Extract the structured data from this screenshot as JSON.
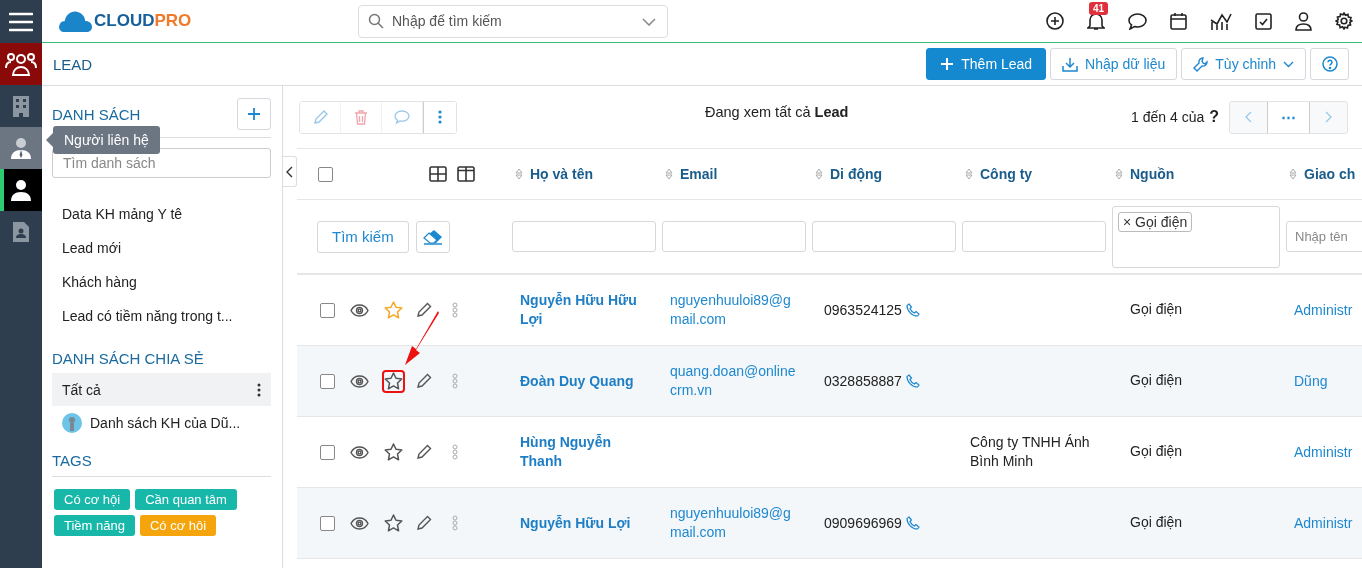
{
  "app": {
    "logo": {
      "part_1": "CLOUD",
      "part_2": "PRO"
    },
    "search": {
      "placeholder": "Nhập để tìm kiếm"
    },
    "notification_count": "41"
  },
  "rail": [
    {
      "kind": "menu",
      "selected": false,
      "hovered": false,
      "open": false
    },
    {
      "kind": "people",
      "selected": true,
      "hovered": false,
      "open": false
    },
    {
      "kind": "building",
      "selected": false,
      "hovered": false,
      "open": false
    },
    {
      "kind": "contact",
      "selected": false,
      "hovered": true,
      "open": false,
      "tooltip": "Người liên hệ"
    },
    {
      "kind": "person",
      "selected": false,
      "hovered": false,
      "open": true
    },
    {
      "kind": "document",
      "selected": false,
      "hovered": false,
      "open": false
    }
  ],
  "page": {
    "title": "LEAD",
    "buttons": [
      {
        "kind": "primary",
        "label": "Thêm Lead"
      },
      {
        "kind": "default",
        "label": "Nhập dữ liệu"
      },
      {
        "kind": "dropdown",
        "label": "Tùy chỉnh"
      },
      {
        "kind": "help"
      }
    ]
  },
  "sidebar": {
    "lists_title": "DANH SÁCH",
    "search": {
      "placeholder": "Tìm danh sách"
    },
    "lists": [
      {
        "label": "Data KH mảng Y tê"
      },
      {
        "label": "Lead mới"
      },
      {
        "label": "Khách hàng"
      },
      {
        "label": "Lead có tiềm năng trong t..."
      }
    ],
    "shared_title": "DANH SÁCH CHIA SẺ",
    "shared": [
      {
        "label": "Tất cả",
        "selected": true,
        "avatar": false
      },
      {
        "label": "Danh sách KH của Dũ...",
        "selected": false,
        "avatar": true
      }
    ],
    "tags_title": "TAGS",
    "tags": [
      {
        "label": "Có cơ hội",
        "color": "#17b8a9"
      },
      {
        "label": "Cần quan tâm",
        "color": "#17b8a9"
      },
      {
        "label": "Tiềm năng",
        "color": "#17b8a9"
      },
      {
        "label": "Có cơ hôi",
        "color": "#f5a40c"
      }
    ]
  },
  "main": {
    "toolbar": [
      {
        "kind": "edit",
        "disabled": true
      },
      {
        "kind": "delete",
        "disabled": true
      },
      {
        "kind": "comment",
        "disabled": true
      },
      {
        "kind": "more",
        "disabled": false
      }
    ],
    "heading": "Đang xem tất cả **Lead**",
    "pagination": "1 đến 4 của",
    "pagination_total": "?",
    "pager_more": "⋯"
  },
  "table": {
    "columns": [
      {
        "label": "Họ và tên"
      },
      {
        "label": "Email"
      },
      {
        "label": "Di động"
      },
      {
        "label": "Công ty"
      },
      {
        "label": "Nguồn"
      },
      {
        "label": "Giao ch"
      }
    ],
    "select_all_checked": false,
    "filters": {
      "search_button": "Tìm kiếm",
      "source_tags": [
        {
          "remove": "×",
          "label": "Gọi điện"
        }
      ],
      "assignee_placeholder": "Nhập tên"
    },
    "rows": [
      {
        "checked": false,
        "starred": true,
        "marked": false,
        "name": "Nguyễn Hữu Hữu Lợi",
        "email": "nguyenhuuloi89@gmail.com",
        "phone": "0963524125",
        "source": "Gọi điện",
        "assignee": "Administr"
      },
      {
        "checked": false,
        "starred": false,
        "marked": true,
        "name": "Đoàn Duy Quang",
        "email": "quang.doan@onlinecrm.vn",
        "phone": "0328858887",
        "source": "Gọi điện",
        "assignee": "Dũng"
      },
      {
        "checked": false,
        "starred": false,
        "marked": false,
        "name": "Hùng Nguyễn Thanh",
        "company": "Công ty TNHH Ánh Bình Minh",
        "source": "Gọi điện",
        "assignee": "Administr"
      },
      {
        "checked": false,
        "starred": false,
        "marked": false,
        "name": "Nguyễn Hữu Lợi",
        "email": "nguyenhuuloi89@gmail.com",
        "phone": "0909696969",
        "source": "Gọi điện",
        "assignee": "Administr"
      }
    ]
  }
}
